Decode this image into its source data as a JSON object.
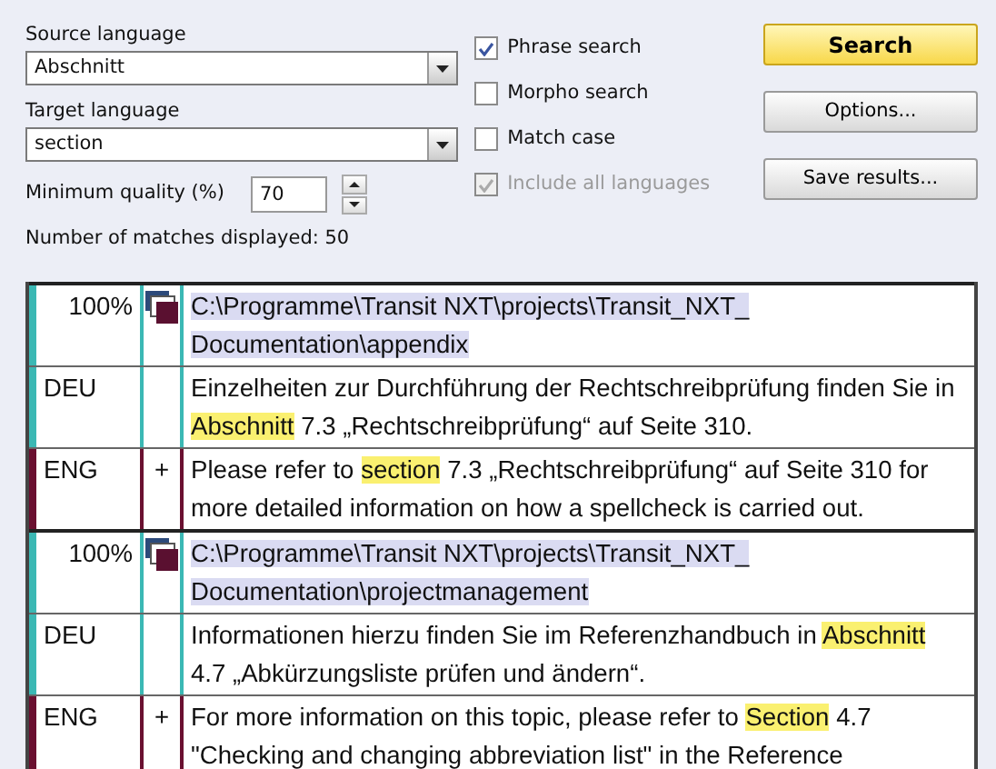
{
  "source": {
    "label": "Source language",
    "value": "Abschnitt"
  },
  "target": {
    "label": "Target language",
    "value": "section"
  },
  "quality": {
    "label": "Minimum quality (%)",
    "value": "70"
  },
  "matches_label": "Number of matches displayed: 50",
  "options": [
    {
      "label": "Phrase search",
      "checked": true,
      "disabled": false
    },
    {
      "label": "Morpho search",
      "checked": false,
      "disabled": false
    },
    {
      "label": "Match case",
      "checked": false,
      "disabled": false
    },
    {
      "label": "Include all languages",
      "checked": true,
      "disabled": true
    }
  ],
  "buttons": [
    {
      "label": "Search",
      "kind": "primary"
    },
    {
      "label": "Options...",
      "kind": "normal"
    },
    {
      "label": "Save results...",
      "kind": "normal"
    }
  ],
  "results": [
    {
      "quality": "100%",
      "path": "C:\\Programme\\Transit NXT\\projects\\Transit_NXT_ Documentation\\appendix",
      "rows": [
        {
          "lang": "DEU",
          "kind": "source",
          "marker": "",
          "segments": [
            {
              "text": "Einzelheiten zur Durchführung der Rechtschreibprüfung finden Sie in ",
              "highlight": false
            },
            {
              "text": "Abschnitt",
              "highlight": true
            },
            {
              "text": " 7.3 „Rechtschreibprüfung“ auf Seite 310.",
              "highlight": false
            }
          ]
        },
        {
          "lang": "ENG",
          "kind": "target",
          "marker": "+",
          "segments": [
            {
              "text": "Please refer to ",
              "highlight": false
            },
            {
              "text": "section",
              "highlight": true
            },
            {
              "text": " 7.3 „Rechtschreibprüfung“ auf Seite 310 for more detailed information on how a spellcheck is carried out.",
              "highlight": false
            }
          ]
        }
      ]
    },
    {
      "quality": "100%",
      "path": "C:\\Programme\\Transit NXT\\projects\\Transit_NXT_ Documentation\\projectmanagement",
      "rows": [
        {
          "lang": "DEU",
          "kind": "source",
          "marker": "",
          "segments": [
            {
              "text": "Informationen hierzu finden Sie im Referenzhandbuch in ",
              "highlight": false
            },
            {
              "text": "Abschnitt",
              "highlight": true
            },
            {
              "text": " 4.7 „Abkürzungsliste prüfen und ändern“.",
              "highlight": false
            }
          ]
        },
        {
          "lang": "ENG",
          "kind": "target",
          "marker": "+",
          "segments": [
            {
              "text": "For more information on this topic, please refer to ",
              "highlight": false
            },
            {
              "text": "Section",
              "highlight": true
            },
            {
              "text": " 4.7 \"Checking and changing abbreviation list\" in the Reference",
              "highlight": false
            }
          ]
        }
      ]
    }
  ]
}
